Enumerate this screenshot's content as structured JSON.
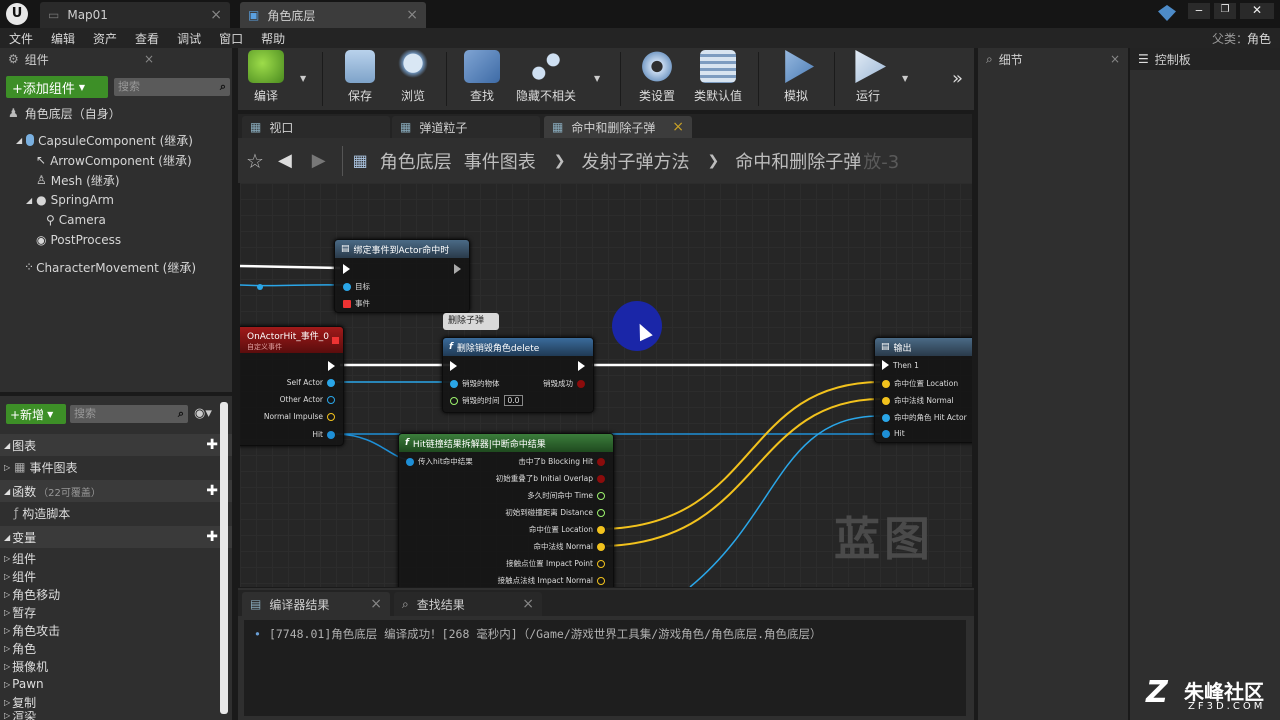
{
  "titlebar": {
    "tabs": [
      {
        "label": "Map01"
      },
      {
        "label": "角色底层"
      }
    ],
    "parent_class_label": "父类：",
    "parent_class_value": "角色"
  },
  "menu": [
    "文件",
    "编辑",
    "资产",
    "查看",
    "调试",
    "窗口",
    "帮助"
  ],
  "components_panel": {
    "title": "组件",
    "add_button": "+添加组件",
    "search_placeholder": "搜索",
    "self_label": "角色底层（自身）",
    "tree": [
      "CapsuleComponent (继承)",
      "ArrowComponent (继承)",
      "Mesh (继承)",
      "SpringArm",
      "Camera",
      "PostProcess",
      "CharacterMovement (继承)"
    ]
  },
  "mybp_panel": {
    "new_button": "+新增",
    "search_placeholder": "搜索",
    "graphs_label": "图表",
    "event_graph_label": "事件图表",
    "functions_label": "函数",
    "functions_override": "（22可覆盖）",
    "construct_label": "构造脚本",
    "variables_label": "变量",
    "categories": [
      "组件",
      "组件",
      "角色移动",
      "暂存",
      "角色攻击",
      "角色",
      "摄像机",
      "Pawn",
      "复制",
      "渲染"
    ]
  },
  "toolbar": {
    "buttons": [
      "编译",
      "保存",
      "浏览",
      "查找",
      "隐藏不相关",
      "类设置",
      "类默认值",
      "模拟",
      "运行"
    ]
  },
  "editor_tabs": [
    "视口",
    "弹道粒子",
    "命中和删除子弹"
  ],
  "breadcrumb": [
    "角色底层",
    "事件图表",
    "发射子弹方法",
    "命中和删除子弹"
  ],
  "breadcrumb_overflow": "放-3",
  "graph": {
    "watermark": "蓝图",
    "nodes": {
      "bind": {
        "title": "绑定事件到Actor命中时",
        "pins": [
          "目标",
          "事件"
        ]
      },
      "event": {
        "title": "OnActorHit_事件_0",
        "subtitle": "自定义事件",
        "pins": [
          "Self Actor",
          "Other Actor",
          "Normal Impulse",
          "Hit"
        ]
      },
      "comment": "删除子弹",
      "destroy": {
        "title": "删除销毁角色delete",
        "in_pins": [
          "销毁的物体",
          "销毁的时间"
        ],
        "out_pins": [
          "销毁成功"
        ],
        "time_value": "0.0"
      },
      "break_hit": {
        "title": "Hit链撞结果拆解器|中断命中结果",
        "in_pin": "传入hit命中结果",
        "out_pins": [
          "击中了b Blocking Hit",
          "初始重叠了b Initial Overlap",
          "多久时间命中 Time",
          "初始到碰撞距离 Distance",
          "命中位置 Location",
          "命中法线 Normal",
          "接触点位置 Impact Point",
          "接触点法线 Impact Normal"
        ]
      },
      "output": {
        "title": "输出",
        "pins": [
          "Then 1",
          "命中位置 Location",
          "命中法线 Normal",
          "命中的角色 Hit Actor",
          "Hit"
        ]
      }
    }
  },
  "right_panels": {
    "details": "细节",
    "palette": "控制板"
  },
  "bottom": {
    "tabs": [
      "编译器结果",
      "查找结果"
    ],
    "log": "[7748.01]角色底层 编译成功！[268 毫秒内]（/Game/游戏世界工具集/游戏角色/角色底层.角色底层）"
  },
  "logo": {
    "name": "朱峰社区",
    "url": "ZF3D.COM"
  },
  "colors": {
    "exec": "#ffffff",
    "object": "#2aa6e8",
    "vector": "#f2c21d",
    "struct": "#1e8fd6",
    "float": "#9cf26d",
    "bool": "#8b0c0c"
  }
}
